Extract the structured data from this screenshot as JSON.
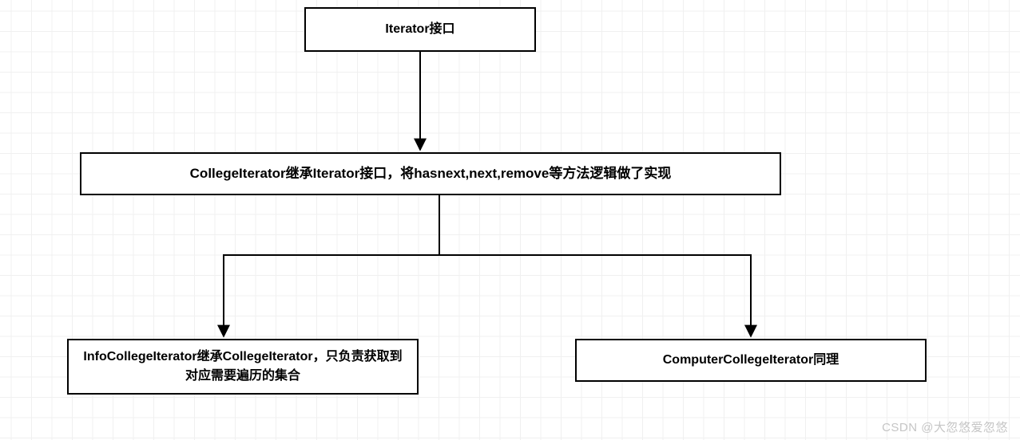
{
  "nodes": {
    "iterator_interface": "Iterator接口",
    "college_iterator": "CollegeIterator继承Iterator接口，将hasnext,next,remove等方法逻辑做了实现",
    "info_college_iterator": "InfoCollegeIterator继承CollegeIterator，只负责获取到对应需要遍历的集合",
    "computer_college_iterator": "ComputerCollegeIterator同理"
  },
  "watermark": "CSDN @大忽悠爱忽悠"
}
